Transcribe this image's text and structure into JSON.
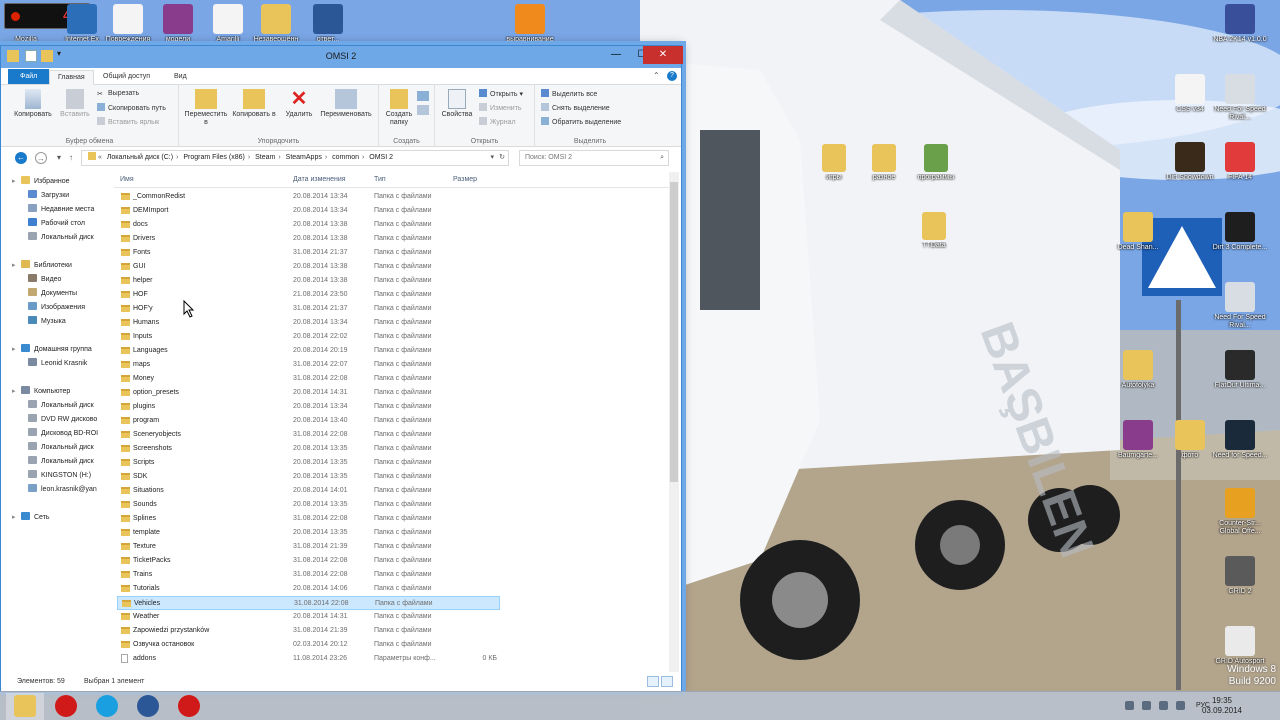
{
  "recorder": {
    "digits": "42"
  },
  "desktop_left_icons": [
    {
      "label": "Mozilla",
      "color": "#c04a2a"
    },
    {
      "label": "Internet Ex",
      "color": "#2c6fb8"
    },
    {
      "label": "Повреждения",
      "color": "#f4f4f4"
    },
    {
      "label": "модели",
      "color": "#8a3c8c"
    },
    {
      "label": "Amarilli",
      "color": "#f4f4f4"
    },
    {
      "label": "Незавершённ",
      "color": "#e8c45a"
    },
    {
      "label": "ответ...",
      "color": "#2b5797"
    },
    {
      "label": "выравнивание",
      "color": "#f08a1c"
    }
  ],
  "desktop_right_icons": [
    {
      "label": "NBA 2K14 v1.0.0",
      "color": "#3a4f9a"
    },
    {
      "label": "CSS v34",
      "color": "#f4f4f4"
    },
    {
      "label": "Need For Speed Rival...",
      "color": "#d8dde3"
    },
    {
      "label": "Dirt Showdown",
      "color": "#3a2a1a"
    },
    {
      "label": "FIFA 14",
      "color": "#e23b3b"
    },
    {
      "label": "Dead Shan...",
      "color": "#e8c45a"
    },
    {
      "label": "Dirt 3 Complete...",
      "color": "#1e1e1e"
    },
    {
      "label": "Need For Speed Rival...",
      "color": "#d8dde3"
    },
    {
      "label": "Autofolyka",
      "color": "#e8c45a"
    },
    {
      "label": "FlatOut Ultima...",
      "color": "#2a2a2a"
    },
    {
      "label": "Baumgarte...",
      "color": "#8a3c8c"
    },
    {
      "label": "фото",
      "color": "#e8c45a"
    },
    {
      "label": "Need for Speed...",
      "color": "#1a2a3a"
    },
    {
      "label": "Counter-Str... Global Offe...",
      "color": "#e8a020"
    },
    {
      "label": "GRID 2",
      "color": "#5a5a5a"
    },
    {
      "label": "GRID Autosport",
      "color": "#eaeaea"
    }
  ],
  "desktop_mid_icons": [
    {
      "label": "игры",
      "color": "#e8c45a"
    },
    {
      "label": "разное",
      "color": "#e8c45a"
    },
    {
      "label": "программы",
      "color": "#6aa04a"
    },
    {
      "label": "TTData",
      "color": "#e8c45a"
    }
  ],
  "window": {
    "title": "OMSI 2",
    "tabs": [
      "Файл",
      "Главная",
      "Общий доступ",
      "Вид"
    ],
    "ribbon": {
      "clipboard": {
        "label": "Буфер обмена",
        "copy": "Копировать",
        "paste": "Вставить",
        "cut": "Вырезать",
        "copy_path": "Скопировать путь",
        "paste_shortcut": "Вставить ярлык"
      },
      "organize": {
        "label": "Упорядочить",
        "move": "Переместить в",
        "copy_to": "Копировать в",
        "delete": "Удалить",
        "rename": "Переименовать"
      },
      "create": {
        "label": "Создать",
        "new_folder": "Создать папку"
      },
      "open": {
        "label": "Открыть",
        "properties": "Свойства",
        "open": "Открыть",
        "edit": "Изменить",
        "history": "Журнал"
      },
      "select": {
        "label": "Выделить",
        "select_all": "Выделить все",
        "select_none": "Снять выделение",
        "invert": "Обратить выделение"
      }
    },
    "address": {
      "crumbs": [
        "Локальный диск (C:)",
        "Program Files (x86)",
        "Steam",
        "SteamApps",
        "common",
        "OMSI 2"
      ],
      "search_placeholder": "Поиск: OMSI 2"
    },
    "nav": [
      {
        "label": "Избранное",
        "level": 0,
        "color": "#e8c45a"
      },
      {
        "label": "Загрузки",
        "level": 1,
        "color": "#5a8ad0"
      },
      {
        "label": "Недавние места",
        "level": 1,
        "color": "#8aa0c0"
      },
      {
        "label": "Рабочий стол",
        "level": 1,
        "color": "#3f7fd0"
      },
      {
        "label": "Локальный диск",
        "level": 1,
        "color": "#9aa4b0"
      },
      {
        "label": "Библиотеки",
        "level": 0,
        "color": "#e0b850"
      },
      {
        "label": "Видео",
        "level": 1,
        "color": "#8a7a6a"
      },
      {
        "label": "Документы",
        "level": 1,
        "color": "#c0a870"
      },
      {
        "label": "Изображения",
        "level": 1,
        "color": "#6a9ac8"
      },
      {
        "label": "Музыка",
        "level": 1,
        "color": "#4a8ab8"
      },
      {
        "label": "Домашняя группа",
        "level": 0,
        "color": "#3a8ad0"
      },
      {
        "label": "Leonid Krasnik",
        "level": 1,
        "color": "#7a8aa0"
      },
      {
        "label": "Компьютер",
        "level": 0,
        "color": "#7a8aa0"
      },
      {
        "label": "Локальный диск",
        "level": 1,
        "color": "#9aa4b0"
      },
      {
        "label": "DVD RW дисково",
        "level": 1,
        "color": "#9aa4b0"
      },
      {
        "label": "Дисковод BD-ROI",
        "level": 1,
        "color": "#9aa4b0"
      },
      {
        "label": "Локальный диск",
        "level": 1,
        "color": "#9aa4b0"
      },
      {
        "label": "Локальный диск",
        "level": 1,
        "color": "#9aa4b0"
      },
      {
        "label": "KINGSTON (H:)",
        "level": 1,
        "color": "#9aa4b0"
      },
      {
        "label": "leon.krasnik@yan",
        "level": 1,
        "color": "#7aa0c8"
      },
      {
        "label": "Сеть",
        "level": 0,
        "color": "#3a8ad0"
      }
    ],
    "columns": [
      "Имя",
      "Дата изменения",
      "Тип",
      "Размер"
    ],
    "files": [
      {
        "name": "_CommonRedist",
        "date": "20.08.2014 13:34",
        "type": "Папка с файлами",
        "size": "",
        "kind": "folder"
      },
      {
        "name": "DEMImport",
        "date": "20.08.2014 13:34",
        "type": "Папка с файлами",
        "size": "",
        "kind": "folder"
      },
      {
        "name": "docs",
        "date": "20.08.2014 13:38",
        "type": "Папка с файлами",
        "size": "",
        "kind": "folder"
      },
      {
        "name": "Drivers",
        "date": "20.08.2014 13:38",
        "type": "Папка с файлами",
        "size": "",
        "kind": "folder"
      },
      {
        "name": "Fonts",
        "date": "31.08.2014 21:37",
        "type": "Папка с файлами",
        "size": "",
        "kind": "folder"
      },
      {
        "name": "GUI",
        "date": "20.08.2014 13:38",
        "type": "Папка с файлами",
        "size": "",
        "kind": "folder"
      },
      {
        "name": "helper",
        "date": "20.08.2014 13:38",
        "type": "Папка с файлами",
        "size": "",
        "kind": "folder"
      },
      {
        "name": "HOF",
        "date": "21.08.2014 23:50",
        "type": "Папка с файлами",
        "size": "",
        "kind": "folder"
      },
      {
        "name": "HOF'y",
        "date": "31.08.2014 21:37",
        "type": "Папка с файлами",
        "size": "",
        "kind": "folder"
      },
      {
        "name": "Humans",
        "date": "20.08.2014 13:34",
        "type": "Папка с файлами",
        "size": "",
        "kind": "folder"
      },
      {
        "name": "Inputs",
        "date": "20.08.2014 22:02",
        "type": "Папка с файлами",
        "size": "",
        "kind": "folder"
      },
      {
        "name": "Languages",
        "date": "20.08.2014 20:19",
        "type": "Папка с файлами",
        "size": "",
        "kind": "folder"
      },
      {
        "name": "maps",
        "date": "31.08.2014 22:07",
        "type": "Папка с файлами",
        "size": "",
        "kind": "folder"
      },
      {
        "name": "Money",
        "date": "31.08.2014 22:08",
        "type": "Папка с файлами",
        "size": "",
        "kind": "folder"
      },
      {
        "name": "option_presets",
        "date": "20.08.2014 14:31",
        "type": "Папка с файлами",
        "size": "",
        "kind": "folder"
      },
      {
        "name": "plugins",
        "date": "20.08.2014 13:34",
        "type": "Папка с файлами",
        "size": "",
        "kind": "folder"
      },
      {
        "name": "program",
        "date": "20.08.2014 13:40",
        "type": "Папка с файлами",
        "size": "",
        "kind": "folder"
      },
      {
        "name": "Sceneryobjects",
        "date": "31.08.2014 22:08",
        "type": "Папка с файлами",
        "size": "",
        "kind": "folder"
      },
      {
        "name": "Screenshots",
        "date": "20.08.2014 13:35",
        "type": "Папка с файлами",
        "size": "",
        "kind": "folder"
      },
      {
        "name": "Scripts",
        "date": "20.08.2014 13:35",
        "type": "Папка с файлами",
        "size": "",
        "kind": "folder"
      },
      {
        "name": "SDK",
        "date": "20.08.2014 13:35",
        "type": "Папка с файлами",
        "size": "",
        "kind": "folder"
      },
      {
        "name": "Situations",
        "date": "20.08.2014 14:01",
        "type": "Папка с файлами",
        "size": "",
        "kind": "folder"
      },
      {
        "name": "Sounds",
        "date": "20.08.2014 13:35",
        "type": "Папка с файлами",
        "size": "",
        "kind": "folder"
      },
      {
        "name": "Splines",
        "date": "31.08.2014 22:08",
        "type": "Папка с файлами",
        "size": "",
        "kind": "folder"
      },
      {
        "name": "template",
        "date": "20.08.2014 13:35",
        "type": "Папка с файлами",
        "size": "",
        "kind": "folder"
      },
      {
        "name": "Texture",
        "date": "31.08.2014 21:39",
        "type": "Папка с файлами",
        "size": "",
        "kind": "folder"
      },
      {
        "name": "TicketPacks",
        "date": "31.08.2014 22:08",
        "type": "Папка с файлами",
        "size": "",
        "kind": "folder"
      },
      {
        "name": "Trains",
        "date": "31.08.2014 22:08",
        "type": "Папка с файлами",
        "size": "",
        "kind": "folder"
      },
      {
        "name": "Tutorials",
        "date": "20.08.2014 14:06",
        "type": "Папка с файлами",
        "size": "",
        "kind": "folder"
      },
      {
        "name": "Vehicles",
        "date": "31.08.2014 22:08",
        "type": "Папка с файлами",
        "size": "",
        "kind": "folder",
        "selected": true
      },
      {
        "name": "Weather",
        "date": "20.08.2014 14:31",
        "type": "Папка с файлами",
        "size": "",
        "kind": "folder"
      },
      {
        "name": "Zapowiedzi przystanków",
        "date": "31.08.2014 21:39",
        "type": "Папка с файлами",
        "size": "",
        "kind": "folder"
      },
      {
        "name": "Озвучка остановок",
        "date": "02.03.2014 20:12",
        "type": "Папка с файлами",
        "size": "",
        "kind": "folder"
      },
      {
        "name": "addons",
        "date": "11.08.2014 23:26",
        "type": "Параметры конф...",
        "size": "0 КБ",
        "kind": "file"
      }
    ],
    "status": {
      "count": "Элементов: 59",
      "selected": "Выбран 1 элемент"
    }
  },
  "taskbar": {
    "apps": [
      {
        "name": "explorer",
        "color": "#e8c45a"
      },
      {
        "name": "opera",
        "color": "#d01a1a"
      },
      {
        "name": "skype",
        "color": "#1aa0e0"
      },
      {
        "name": "word",
        "color": "#2b5797"
      },
      {
        "name": "recorder",
        "color": "#d01a1a"
      }
    ],
    "lang": "РУС",
    "time": "19:35",
    "date": "03.09.2014"
  },
  "watermark": {
    "line1": "Windows 8",
    "line2": "Build 9200"
  }
}
